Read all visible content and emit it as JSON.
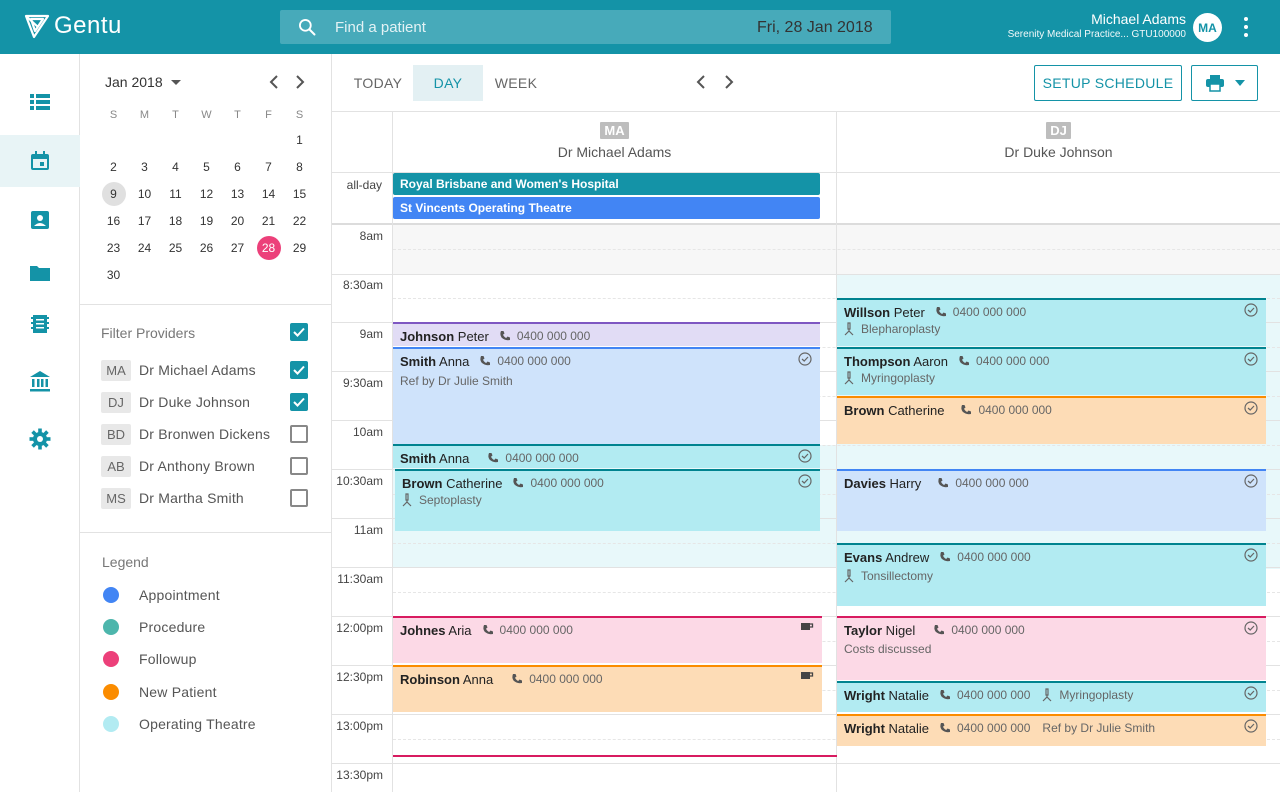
{
  "app": {
    "brand": "Gentu"
  },
  "search": {
    "placeholder": "Find a patient"
  },
  "user": {
    "name": "Michael Adams",
    "practice": "Serenity Medical Practice...  GTU100000",
    "initials": "MA"
  },
  "mini_calendar": {
    "month_label": "Jan 2018",
    "weekdays": [
      "S",
      "M",
      "T",
      "W",
      "T",
      "F",
      "S"
    ],
    "weeks": [
      [
        "",
        "",
        "",
        "",
        "",
        "",
        "1"
      ],
      [
        "2",
        "3",
        "4",
        "5",
        "6",
        "7",
        "8"
      ],
      [
        "9",
        "10",
        "11",
        "12",
        "13",
        "14",
        "15"
      ],
      [
        "16",
        "17",
        "18",
        "19",
        "20",
        "21",
        "22"
      ],
      [
        "23",
        "24",
        "25",
        "26",
        "27",
        "28",
        "29"
      ],
      [
        "30",
        "",
        "",
        "",
        "",
        "",
        ""
      ]
    ],
    "today": "9",
    "selected": "28"
  },
  "filter": {
    "title": "Filter Providers",
    "all_checked": true,
    "providers": [
      {
        "initials": "MA",
        "name": "Dr Michael Adams",
        "checked": true
      },
      {
        "initials": "DJ",
        "name": "Dr Duke Johnson",
        "checked": true
      },
      {
        "initials": "BD",
        "name": "Dr Bronwen Dickens",
        "checked": false
      },
      {
        "initials": "AB",
        "name": "Dr Anthony Brown",
        "checked": false
      },
      {
        "initials": "MS",
        "name": "Dr Martha Smith",
        "checked": false
      }
    ]
  },
  "legend": {
    "title": "Legend",
    "items": [
      {
        "label": "Appointment",
        "color": "#4285f4"
      },
      {
        "label": "Procedure",
        "color": "#4db6ac"
      },
      {
        "label": "Followup",
        "color": "#ec407a"
      },
      {
        "label": "New Patient",
        "color": "#fb8c00"
      },
      {
        "label": "Operating Theatre",
        "color": "#b2ebf2"
      }
    ]
  },
  "toolbar": {
    "today": "TODAY",
    "day": "DAY",
    "week": "WEEK",
    "date": "Fri, 28 Jan 2018",
    "setup": "SETUP SCHEDULE"
  },
  "schedule": {
    "allday_label": "all-day",
    "columns": [
      {
        "initials": "MA",
        "doctor": "Dr Michael Adams"
      },
      {
        "initials": "DJ",
        "doctor": "Dr Duke Johnson"
      }
    ],
    "times": [
      "8am",
      "8:30am",
      "9am",
      "9:30am",
      "10am",
      "10:30am",
      "11am",
      "11:30am",
      "12:00pm",
      "12:30pm",
      "13:00pm",
      "13:30pm"
    ],
    "allday_events": [
      {
        "label": "Royal Brisbane and Women's Hospital",
        "color": "#1493a7"
      },
      {
        "label": "St Vincents Operating Theatre",
        "color": "#4285f4"
      }
    ],
    "appointments": {
      "johnson_peter": {
        "last": "Johnson",
        "first": " Peter",
        "phone": "0400 000 000"
      },
      "smith_anna_1": {
        "last": "Smith",
        "first": " Anna",
        "phone": "0400 000 000",
        "note": "Ref by Dr Julie Smith"
      },
      "smith_anna_2": {
        "last": "Smith",
        "first": " Anna",
        "phone": "0400 000 000"
      },
      "brown_catherine_1": {
        "last": "Brown",
        "first": " Catherine",
        "phone": "0400 000 000",
        "procedure": "Septoplasty"
      },
      "johnes_aria": {
        "last": "Johnes",
        "first": " Aria",
        "phone": "0400 000 000"
      },
      "robinson_anna": {
        "last": "Robinson",
        "first": " Anna",
        "phone": "0400 000 000"
      },
      "willson_peter": {
        "last": "Willson",
        "first": " Peter",
        "phone": "0400 000 000",
        "procedure": "Blepharoplasty"
      },
      "thompson_aaron": {
        "last": "Thompson",
        "first": " Aaron",
        "phone": "0400 000 000",
        "procedure": "Myringoplasty"
      },
      "brown_catherine_2": {
        "last": "Brown",
        "first": " Catherine",
        "phone": "0400 000 000"
      },
      "davies_harry": {
        "last": "Davies",
        "first": " Harry",
        "phone": "0400 000 000"
      },
      "evans_andrew": {
        "last": "Evans",
        "first": " Andrew",
        "phone": "0400 000 000",
        "procedure": "Tonsillectomy"
      },
      "taylor_nigel": {
        "last": "Taylor",
        "first": " Nigel",
        "phone": "0400 000 000",
        "note": "Costs discussed"
      },
      "wright_natalie_1": {
        "last": "Wright",
        "first": " Natalie",
        "phone": "0400 000 000",
        "procedure": "Myringoplasty"
      },
      "wright_natalie_2": {
        "last": "Wright",
        "first": " Natalie",
        "phone": "0400 000 000",
        "note": "Ref by Dr Julie Smith"
      }
    }
  }
}
